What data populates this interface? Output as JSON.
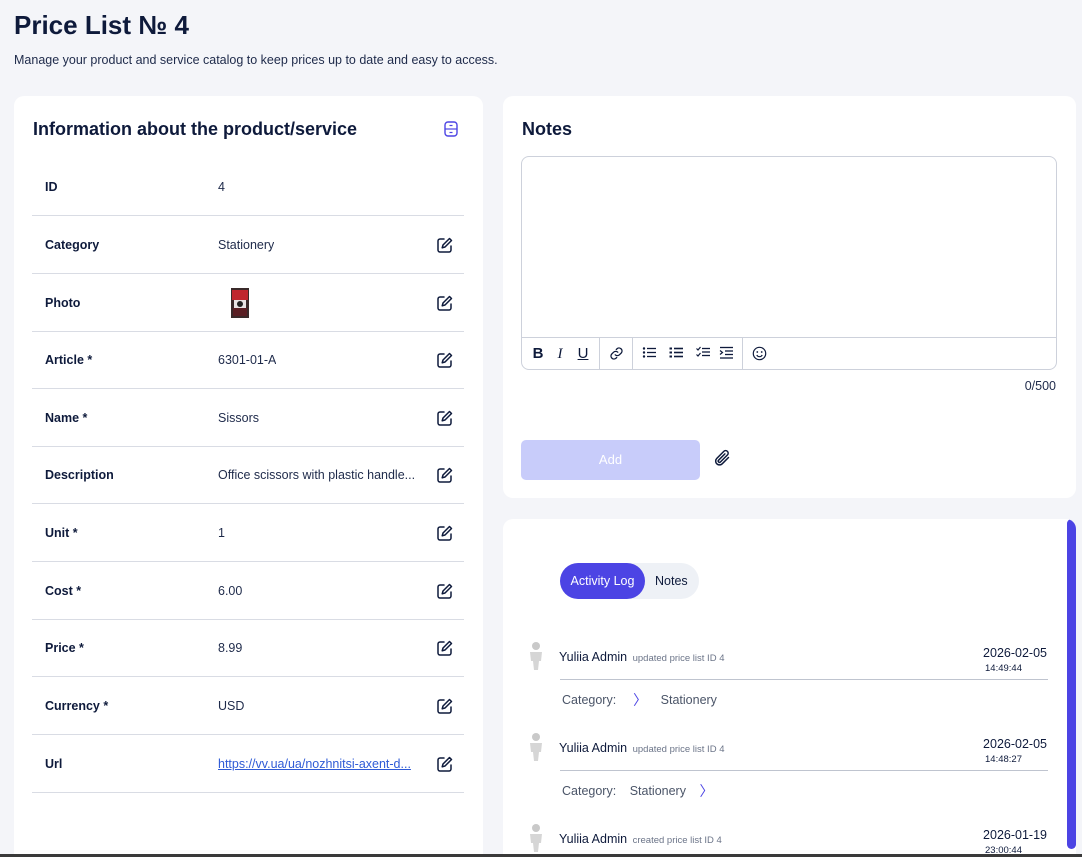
{
  "page": {
    "title": "Price List № 4",
    "subtitle": "Manage your product and service catalog to keep prices up to date and easy to access."
  },
  "info": {
    "title": "Information about the product/service",
    "rows": [
      {
        "label": "ID",
        "value": "4"
      },
      {
        "label": "Category",
        "value": "Stationery"
      },
      {
        "label": "Photo",
        "value": ""
      },
      {
        "label": "Article *",
        "value": "6301-01-A"
      },
      {
        "label": "Name *",
        "value": "Sissors"
      },
      {
        "label": "Description",
        "value": "Office scissors with plastic handle..."
      },
      {
        "label": "Unit *",
        "value": "1"
      },
      {
        "label": "Cost *",
        "value": "6.00"
      },
      {
        "label": "Price *",
        "value": "8.99"
      },
      {
        "label": "Currency *",
        "value": "USD"
      },
      {
        "label": "Url",
        "value": "https://vv.ua/ua/nozhnitsi-axent-d..."
      }
    ]
  },
  "notes": {
    "title": "Notes",
    "counter": "0/500",
    "add_label": "Add",
    "toolbar": {
      "bold": "B",
      "italic": "I",
      "underline": "U"
    }
  },
  "activity": {
    "tabs": {
      "active": "Activity Log",
      "inactive": "Notes"
    },
    "entries": [
      {
        "user": "Yuliia Admin",
        "action": "updated price list ID 4",
        "date": "2026-02-05",
        "time": "14:49:44",
        "field": "Category:",
        "old": "",
        "new": "Stationery"
      },
      {
        "user": "Yuliia Admin",
        "action": "updated price list ID 4",
        "date": "2026-02-05",
        "time": "14:48:27",
        "field": "Category:",
        "old": "Stationery",
        "new": ""
      },
      {
        "user": "Yuliia Admin",
        "action": "created price list ID 4",
        "date": "2026-01-19",
        "time": "23:00:44"
      }
    ]
  },
  "colors": {
    "accent": "#4c44e4",
    "add_disabled": "#c8ccfa",
    "title": "#0e1a3b"
  }
}
